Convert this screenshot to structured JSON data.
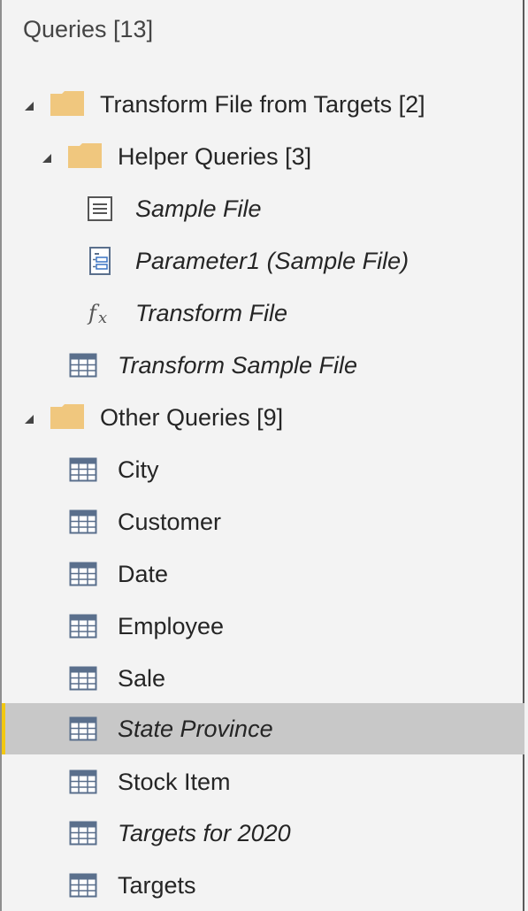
{
  "panel": {
    "title": "Queries [13]"
  },
  "groups": [
    {
      "label": "Transform File from Targets [2]",
      "expanded": true,
      "icon": "folder-icon"
    },
    {
      "label": "Helper Queries [3]",
      "expanded": true,
      "icon": "folder-icon"
    },
    {
      "label": "Other Queries [9]",
      "expanded": true,
      "icon": "folder-icon"
    }
  ],
  "helper_items": [
    {
      "label": "Sample File",
      "icon": "document-icon",
      "italic": true
    },
    {
      "label": "Parameter1 (Sample File)",
      "icon": "parameter-icon",
      "italic": true
    },
    {
      "label": "Transform File",
      "icon": "function-icon",
      "italic": true
    }
  ],
  "transform_items": [
    {
      "label": "Transform Sample File",
      "icon": "table-icon",
      "italic": true
    }
  ],
  "other_items": [
    {
      "label": "City",
      "icon": "table-icon",
      "italic": false
    },
    {
      "label": "Customer",
      "icon": "table-icon",
      "italic": false
    },
    {
      "label": "Date",
      "icon": "table-icon",
      "italic": false
    },
    {
      "label": "Employee",
      "icon": "table-icon",
      "italic": false
    },
    {
      "label": "Sale",
      "icon": "table-icon",
      "italic": false
    },
    {
      "label": "State Province",
      "icon": "table-icon",
      "italic": true,
      "selected": true
    },
    {
      "label": "Stock Item",
      "icon": "table-icon",
      "italic": false
    },
    {
      "label": "Targets for 2020",
      "icon": "table-icon",
      "italic": true
    },
    {
      "label": "Targets",
      "icon": "table-icon",
      "italic": false
    }
  ],
  "colors": {
    "folder": "#f0c77e",
    "selection": "#c8c8c8",
    "selection_accent": "#f2c811",
    "icon": "#5a6f8c"
  }
}
